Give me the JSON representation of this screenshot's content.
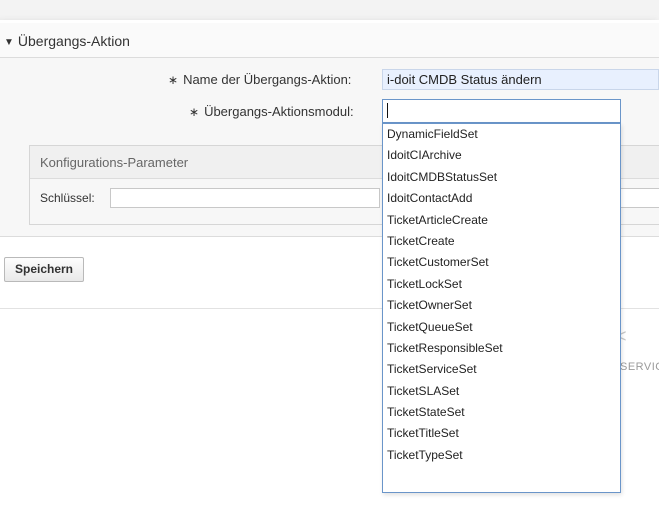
{
  "section": {
    "title": "Übergangs-Aktion"
  },
  "form": {
    "name_label": "Name der Übergangs-Aktion:",
    "name_value": "i-doit CMDB Status ändern",
    "module_label": "Übergangs-Aktionsmodul:",
    "module_value": "",
    "required_marker": "∗"
  },
  "config": {
    "title": "Konfigurations-Parameter",
    "key_label": "Schlüssel:"
  },
  "buttons": {
    "save": "Speichern"
  },
  "dropdown": {
    "options": [
      "DynamicFieldSet",
      "IdoitCIArchive",
      "IdoitCMDBStatusSet",
      "IdoitContactAdd",
      "TicketArticleCreate",
      "TicketCreate",
      "TicketCustomerSet",
      "TicketLockSet",
      "TicketOwnerSet",
      "TicketQueueSet",
      "TicketResponsibleSet",
      "TicketServiceSet",
      "TicketSLASet",
      "TicketStateSet",
      "TicketTitleSet",
      "TicketTypeSet"
    ]
  },
  "background": {
    "lt_glyph": "<",
    "service_text": "SERVIC"
  },
  "icons": {
    "collapse": "triangle-down-icon"
  },
  "colors": {
    "focus_border": "#6a95c9",
    "autofill_bg": "#e8f0fe"
  }
}
